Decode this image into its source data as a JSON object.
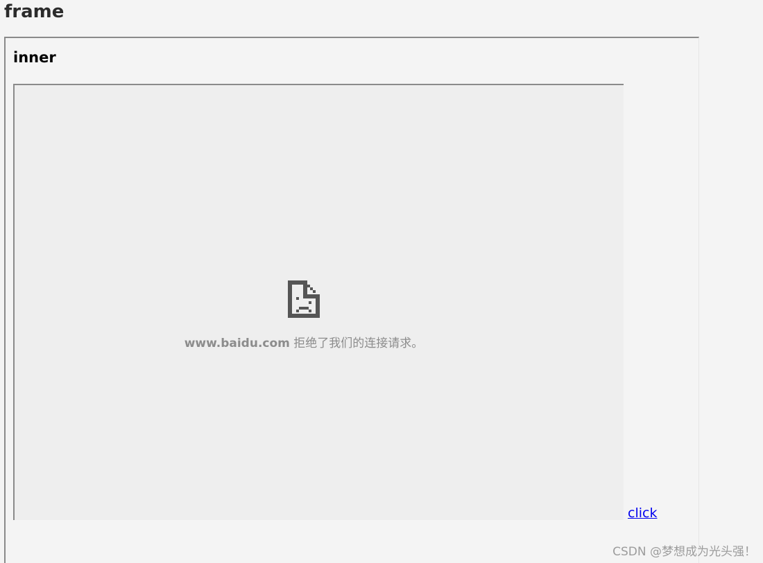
{
  "page": {
    "title": "frame"
  },
  "outer_frame": {
    "heading": "inner",
    "link_label": "click"
  },
  "inner_frame": {
    "error_icon": "sad-document-icon",
    "error_host": "www.baidu.com",
    "error_text": " 拒绝了我们的连接请求。"
  },
  "watermark": {
    "text": "CSDN @梦想成为光头强！"
  },
  "colors": {
    "background": "#f4f4f4",
    "frame_background": "#eeeeee",
    "frame_border": "#8a8a8a",
    "error_text": "#8c8c8c",
    "icon": "#555555",
    "link": "#0000ee"
  }
}
